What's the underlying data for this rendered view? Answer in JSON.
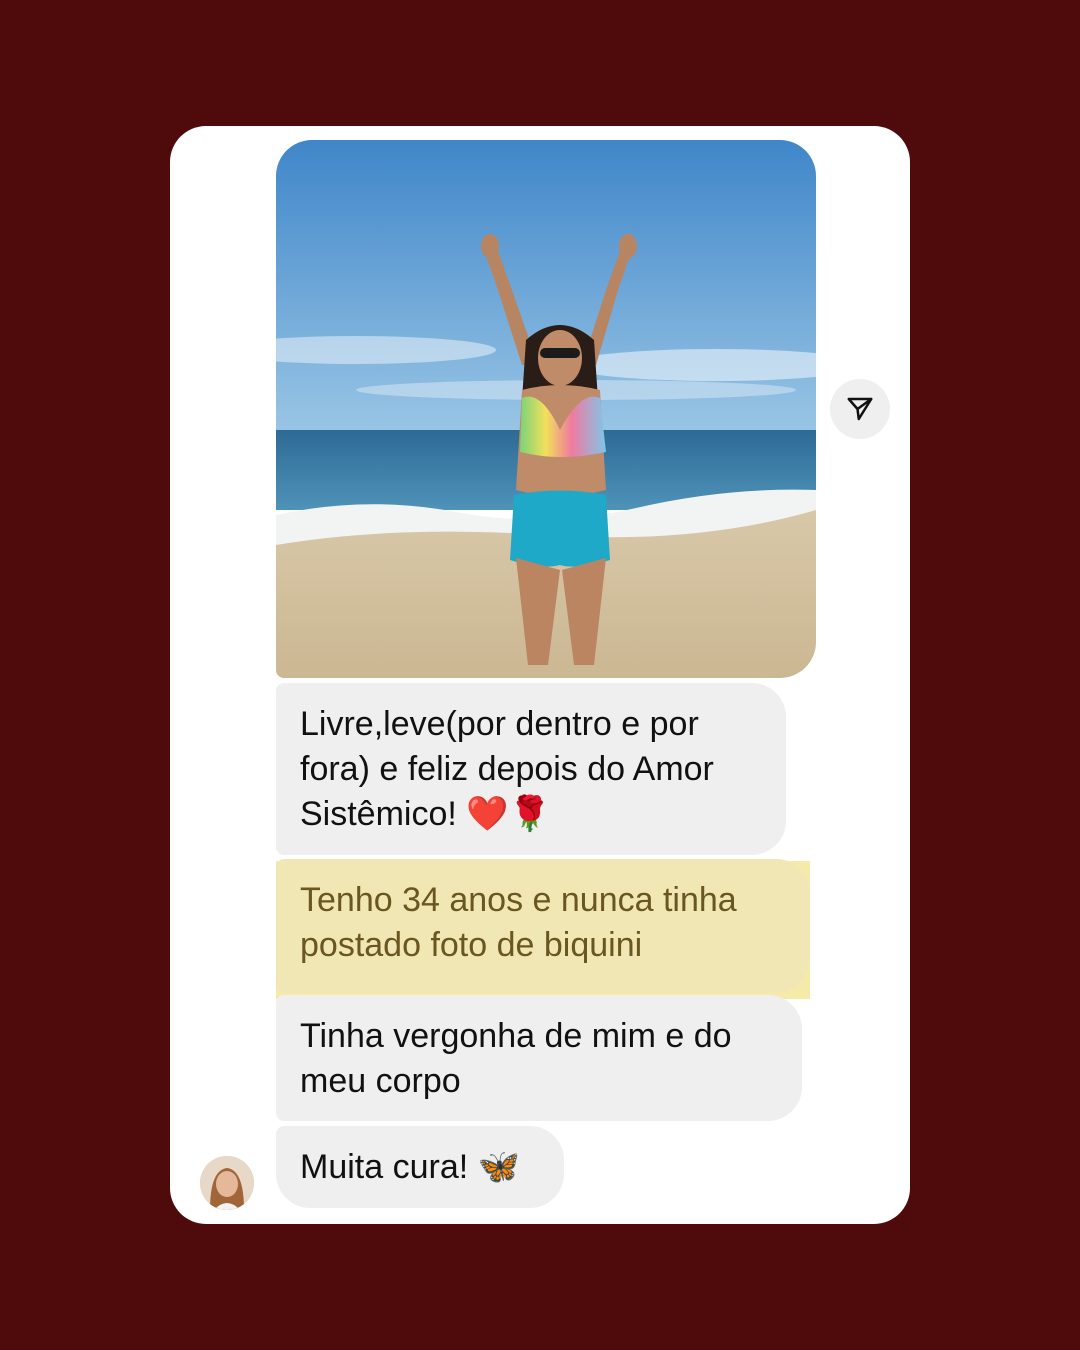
{
  "conversation": {
    "photo_alt": "",
    "messages": [
      {
        "text": "Livre,leve(por dentro e por fora) e feliz depois do Amor Sistêmico! ❤️🌹"
      },
      {
        "text": "Tenho 34 anos e nunca tinha postado foto de biquini",
        "highlighted": true
      },
      {
        "text": "Tinha vergonha de mim e do meu corpo"
      },
      {
        "text": "Muita cura! 🦋"
      }
    ],
    "actions": {
      "share_icon": "send-icon"
    }
  },
  "colors": {
    "background": "#4f0a0b",
    "card": "#ffffff",
    "bubble": "#efefef",
    "highlight": "#f6eaa9",
    "highlight_text": "#6a5620"
  }
}
